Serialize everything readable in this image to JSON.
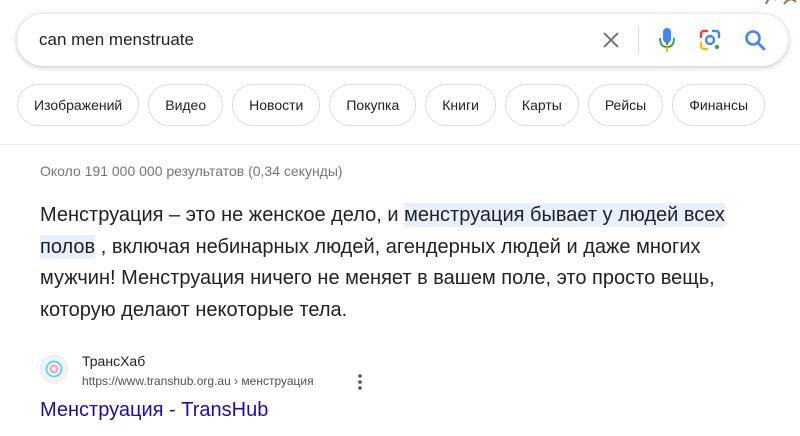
{
  "search": {
    "query": "can men menstruate"
  },
  "chips": [
    {
      "label": "Изображений"
    },
    {
      "label": "Видео"
    },
    {
      "label": "Новости"
    },
    {
      "label": "Покупка"
    },
    {
      "label": "Книги"
    },
    {
      "label": "Карты"
    },
    {
      "label": "Рейсы"
    },
    {
      "label": "Финансы"
    }
  ],
  "results_stats": "Около 191 000 000 результатов (0,34 секунды)",
  "snippet": {
    "before": "Менструация – это не женское дело, и ",
    "highlight": "менструация бывает у людей всех полов",
    "after": " , включая небинарных людей, агендерных людей и даже многих мужчин! Менструация ничего не меняет в вашем поле, это просто вещь, которую делают некоторые тела."
  },
  "result": {
    "site_name": "ТрансХаб",
    "url": "https://www.transhub.org.au › менструация",
    "title": "Менструация - TransHub"
  },
  "icons": {
    "clear": "close-icon",
    "voice": "microphone-icon",
    "lens": "google-lens-icon",
    "search": "search-icon",
    "more": "more-vert-icon",
    "favicon": "transhub-favicon"
  },
  "colors": {
    "link": "#1a0dab",
    "highlight": "#e8f0fe",
    "muted": "#70757a",
    "search_blue": "#4285f4"
  }
}
